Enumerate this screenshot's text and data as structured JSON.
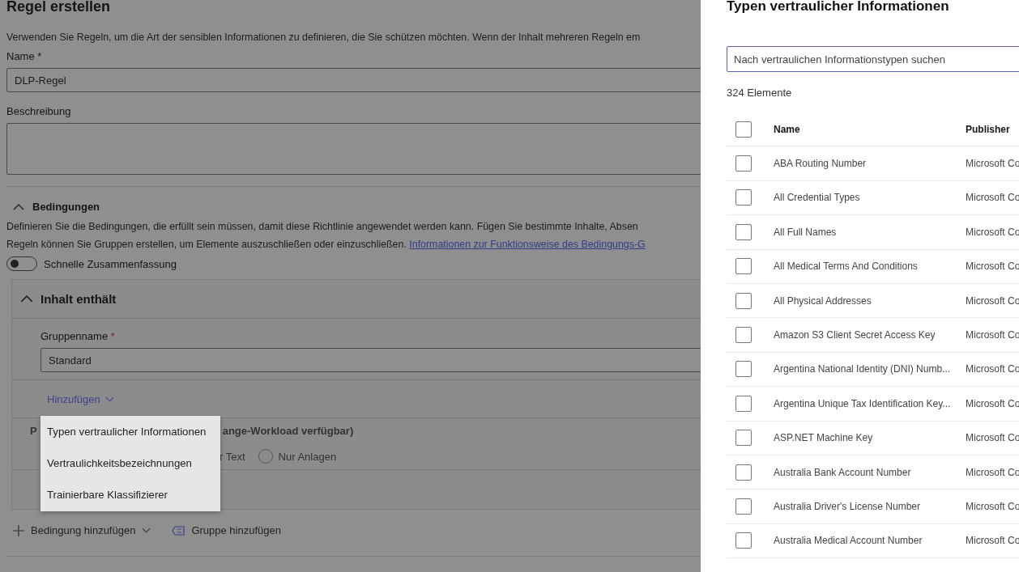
{
  "page": {
    "title": "Regel erstellen",
    "intro": "Verwenden Sie Regeln, um die Art der sensiblen Informationen zu definieren, die Sie schützen möchten. Wenn der Inhalt mehreren Regeln em",
    "name_field": {
      "label": "Name *",
      "value": "DLP-Regel"
    },
    "description_field": {
      "label": "Beschreibung"
    },
    "conditions": {
      "title": "Bedingungen",
      "expanded": true,
      "lines": [
        "Definieren Sie die Bedingungen, die erfüllt sein müssen, damit diese Richtlinie angewendet werden kann. Fügen Sie bestimmte Inhalte, Absen",
        "Regeln können Sie Gruppen erstellen, um Elemente auszuschließen oder einzuschließen."
      ],
      "link": "Informationen zur Funktionsweise des Bedingungs-G"
    },
    "toggle": {
      "label": "Schnelle Zusammenfassung",
      "on": false
    },
    "group": {
      "title": "Inhalt enthält",
      "expanded": true,
      "name_label": "Gruppenname",
      "required_mark": "*",
      "name_value": "Standard",
      "add_button": "Hinzufügen",
      "label_start": "P",
      "label_end": "ange-Workload verfügbar)",
      "partial_option": "r Text",
      "radios": [
        {
          "label": "Nur Anlagen",
          "selected": false
        }
      ]
    },
    "add_menu": {
      "items": [
        "Typen vertraulicher Informationen",
        "Vertraulichkeitsbezeichnungen",
        "Trainierbare Klassifizierer"
      ]
    },
    "footer": {
      "add_condition": "Bedingung hinzufügen",
      "add_group": "Gruppe hinzufügen"
    }
  },
  "panel": {
    "title": "Typen vertraulicher Informationen",
    "search": {
      "placeholder": "Nach vertraulichen Informationstypen suchen"
    },
    "count": "324 Elemente",
    "columns": [
      "Name",
      "Publisher"
    ],
    "all_checked": false,
    "rows": [
      {
        "name": "ABA Routing Number",
        "publisher": "Microsoft Co",
        "checked": false
      },
      {
        "name": "All Credential Types",
        "publisher": "Microsoft Co",
        "checked": false
      },
      {
        "name": "All Full Names",
        "publisher": "Microsoft Co",
        "checked": false
      },
      {
        "name": "All Medical Terms And Conditions",
        "publisher": "Microsoft Co",
        "checked": false
      },
      {
        "name": "All Physical Addresses",
        "publisher": "Microsoft Co",
        "checked": false
      },
      {
        "name": "Amazon S3 Client Secret Access Key",
        "publisher": "Microsoft Co",
        "checked": false
      },
      {
        "name": "Argentina National Identity (DNI) Numb...",
        "publisher": "Microsoft Co",
        "checked": false
      },
      {
        "name": "Argentina Unique Tax Identification Key...",
        "publisher": "Microsoft Co",
        "checked": false
      },
      {
        "name": "ASP.NET Machine Key",
        "publisher": "Microsoft Co",
        "checked": false
      },
      {
        "name": "Australia Bank Account Number",
        "publisher": "Microsoft Co",
        "checked": false
      },
      {
        "name": "Australia Driver's License Number",
        "publisher": "Microsoft Co",
        "checked": false
      },
      {
        "name": "Australia Medical Account Number",
        "publisher": "Microsoft Co",
        "checked": false
      }
    ]
  }
}
